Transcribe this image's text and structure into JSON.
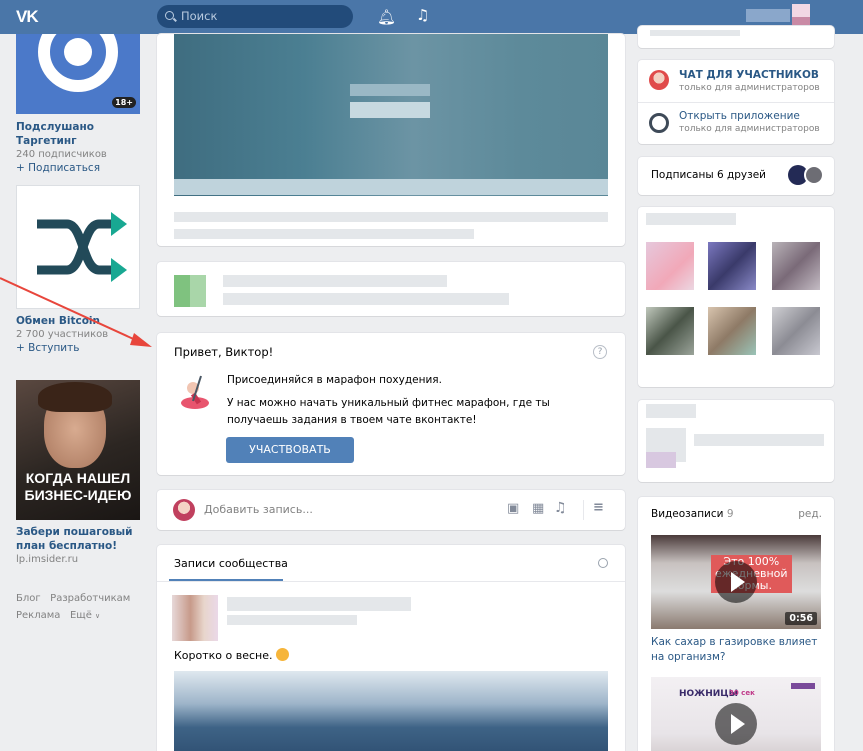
{
  "header": {
    "logo": "VK",
    "search_placeholder": "Поиск"
  },
  "left": {
    "group1": {
      "badge": "18+",
      "title": "Подслушано Таргетинг",
      "subtitle": "240 подписчиков",
      "action": "+ Подписаться"
    },
    "group2": {
      "title": "Обмен Bitcoin",
      "subtitle": "2 700 участников",
      "action": "+ Вступить"
    },
    "ad": {
      "image_text": "КОГДА НАШЕЛ БИЗНЕС-ИДЕЮ",
      "title": "Забери пошаговый план бесплатно!",
      "domain": "lp.imsider.ru"
    },
    "footer": {
      "links": [
        "Блог",
        "Разработчикам",
        "Реклама",
        "Ещё"
      ]
    }
  },
  "center": {
    "greeting": {
      "title": "Привет, Виктор!",
      "help": "?",
      "line1": "Присоединяйся в марафон похудения.",
      "line2": "У нас можно начать уникальный фитнес марафон, где ты получаешь задания в твоем чате вконтакте!",
      "button": "УЧАСТВОВАТЬ"
    },
    "composer": {
      "placeholder": "Добавить запись..."
    },
    "wall": {
      "tab": "Записи сообщества",
      "post_text": "Коротко о весне."
    }
  },
  "right": {
    "chat": {
      "title": "ЧАТ ДЛЯ УЧАСТНИКОВ",
      "subtitle": "только для администраторов"
    },
    "app": {
      "title": "Открыть приложение",
      "subtitle": "только для администраторов"
    },
    "friends": {
      "label": "Подписаны 6 друзей"
    },
    "videos": {
      "title": "Видеозаписи",
      "count": "9",
      "edit": "ред.",
      "v1": {
        "overlay1": "Это 100%",
        "overlay2": "ежедневной",
        "overlay3": "нормы.",
        "duration": "0:56",
        "caption": "Как сахар в газировке влияет на организм?"
      },
      "v2": {
        "overlay": "НОЖНИЦЫ",
        "badge": "30 сек"
      }
    }
  },
  "colors": {
    "header": "#4a76a8",
    "link": "#2a5885",
    "button": "#5181b8",
    "arrow": "#e8463c"
  }
}
